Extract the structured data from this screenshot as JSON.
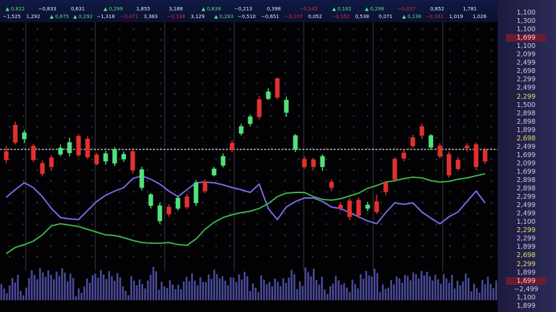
{
  "ticker": {
    "row1": [
      {
        "v": "0,822",
        "dir": "up"
      },
      {
        "v": "−0,833",
        "dir": "flat"
      },
      {
        "v": "0,631",
        "dir": "flat"
      },
      {
        "v": "0,299",
        "dir": "up"
      },
      {
        "v": "1,855",
        "dir": "flat"
      },
      {
        "v": "3,188",
        "dir": "flat"
      },
      {
        "v": "0,839",
        "dir": "up"
      },
      {
        "v": "−0,213",
        "dir": "flat"
      },
      {
        "v": "0,398",
        "dir": "flat"
      },
      {
        "v": "−0,145",
        "dir": "down"
      },
      {
        "v": "0,162",
        "dir": "up"
      },
      {
        "v": "0,298",
        "dir": "up"
      },
      {
        "v": "−0,037",
        "dir": "down"
      },
      {
        "v": "0,852",
        "dir": "flat"
      },
      {
        "v": "1,781",
        "dir": "flat"
      }
    ],
    "row2": [
      {
        "v": "−1,525",
        "dir": "flat"
      },
      {
        "v": "1,292",
        "dir": "flat"
      },
      {
        "v": "0,675",
        "dir": "up"
      },
      {
        "v": "0,292",
        "dir": "up"
      },
      {
        "v": "−1,318",
        "dir": "flat"
      },
      {
        "v": "−0,471",
        "dir": "down"
      },
      {
        "v": "3,383",
        "dir": "flat"
      },
      {
        "v": "−0,138",
        "dir": "down"
      },
      {
        "v": "3,129",
        "dir": "flat"
      },
      {
        "v": "0,293",
        "dir": "up"
      },
      {
        "v": "−0,510",
        "dir": "flat"
      },
      {
        "v": "−0,651",
        "dir": "flat"
      },
      {
        "v": "−0,107",
        "dir": "down"
      },
      {
        "v": "0,052",
        "dir": "flat"
      },
      {
        "v": "−0,152",
        "dir": "down"
      },
      {
        "v": "0,538",
        "dir": "flat"
      },
      {
        "v": "0,071",
        "dir": "flat"
      },
      {
        "v": "0,138",
        "dir": "up"
      },
      {
        "v": "−0,161",
        "dir": "down"
      },
      {
        "v": "1,019",
        "dir": "flat"
      },
      {
        "v": "1,026",
        "dir": "flat"
      }
    ]
  },
  "y_axis_labels": [
    {
      "t": "1,100",
      "c": "w"
    },
    {
      "t": "1,300",
      "c": "w"
    },
    {
      "t": "1,100",
      "c": "w"
    },
    {
      "t": "1,699",
      "c": "hl"
    },
    {
      "t": "1,100",
      "c": "w"
    },
    {
      "t": "2,099",
      "c": "w"
    },
    {
      "t": "2,499",
      "c": "w"
    },
    {
      "t": "2,698",
      "c": "w"
    },
    {
      "t": "2,299",
      "c": "w"
    },
    {
      "t": "2,499",
      "c": "w"
    },
    {
      "t": "2,299",
      "c": "y"
    },
    {
      "t": "1,500",
      "c": "w"
    },
    {
      "t": "2,898",
      "c": "w"
    },
    {
      "t": "2,898",
      "c": "w"
    },
    {
      "t": "1,899",
      "c": "w"
    },
    {
      "t": "2,698",
      "c": "y"
    },
    {
      "t": "2,499",
      "c": "w"
    },
    {
      "t": "1,699",
      "c": "w"
    },
    {
      "t": "2,099",
      "c": "w"
    },
    {
      "t": "1,699",
      "c": "w"
    },
    {
      "t": "2,898",
      "c": "w"
    },
    {
      "t": "2,898",
      "c": "w"
    },
    {
      "t": "2,299",
      "c": "w"
    },
    {
      "t": "2,499",
      "c": "w"
    },
    {
      "t": "2,499",
      "c": "w"
    },
    {
      "t": "1,100",
      "c": "w"
    },
    {
      "t": "2,299",
      "c": "y"
    },
    {
      "t": "2,299",
      "c": "w"
    },
    {
      "t": "1,899",
      "c": "w"
    },
    {
      "t": "2,698",
      "c": "y"
    },
    {
      "t": "2,299",
      "c": "y"
    },
    {
      "t": "1,899",
      "c": "w"
    },
    {
      "t": "1,699",
      "c": "hl"
    },
    {
      "t": "−2,499",
      "c": "w"
    },
    {
      "t": "1,100",
      "c": "w"
    },
    {
      "t": "1,899",
      "c": "w"
    }
  ],
  "colors": {
    "up": "#52e07a",
    "down": "#e03030",
    "line_purple": "#7a6ae8",
    "line_green": "#3cb04a",
    "volume": "#4a4a9c",
    "reference_line": "#ffffff"
  },
  "chart_data": {
    "type": "candlestick",
    "x": [
      1,
      2,
      3,
      4,
      5,
      6,
      7,
      8,
      9,
      10,
      11,
      12,
      13,
      14,
      15,
      16,
      17,
      18,
      19,
      20,
      21,
      22,
      23,
      24,
      25,
      26,
      27,
      28,
      29,
      30,
      31,
      32,
      33,
      34,
      35,
      36,
      37,
      38,
      39,
      40,
      41,
      42,
      43,
      44,
      45,
      46,
      47,
      48,
      49,
      50,
      51,
      52,
      53,
      54
    ],
    "candles": [
      {
        "o": 218,
        "c": 230,
        "h": 210,
        "l": 235
      },
      {
        "o": 180,
        "c": 205,
        "h": 175,
        "l": 208
      },
      {
        "o": 200,
        "c": 191,
        "h": 187,
        "l": 206
      },
      {
        "o": 210,
        "c": 230,
        "h": 207,
        "l": 233
      },
      {
        "o": 235,
        "c": 250,
        "h": 231,
        "l": 254
      },
      {
        "o": 227,
        "c": 240,
        "h": 223,
        "l": 245
      },
      {
        "o": 222,
        "c": 213,
        "h": 208,
        "l": 225
      },
      {
        "o": 220,
        "c": 205,
        "h": 198,
        "l": 225
      },
      {
        "o": 196,
        "c": 223,
        "h": 193,
        "l": 226
      },
      {
        "o": 200,
        "c": 226,
        "h": 196,
        "l": 229
      },
      {
        "o": 223,
        "c": 236,
        "h": 220,
        "l": 238
      },
      {
        "o": 232,
        "c": 221,
        "h": 217,
        "l": 237
      },
      {
        "o": 235,
        "c": 215,
        "h": 212,
        "l": 239
      },
      {
        "o": 229,
        "c": 222,
        "h": 218,
        "l": 233
      },
      {
        "o": 218,
        "c": 245,
        "h": 215,
        "l": 250
      },
      {
        "o": 270,
        "c": 244,
        "h": 240,
        "l": 274
      },
      {
        "o": 296,
        "c": 280,
        "h": 278,
        "l": 300
      },
      {
        "o": 318,
        "c": 296,
        "h": 292,
        "l": 322
      },
      {
        "o": 298,
        "c": 308,
        "h": 294,
        "l": 312
      },
      {
        "o": 300,
        "c": 285,
        "h": 282,
        "l": 303
      },
      {
        "o": 283,
        "c": 298,
        "h": 279,
        "l": 301
      },
      {
        "o": 292,
        "c": 263,
        "h": 259,
        "l": 296
      },
      {
        "o": 262,
        "c": 275,
        "h": 258,
        "l": 278
      },
      {
        "o": 252,
        "c": 243,
        "h": 240,
        "l": 254
      },
      {
        "o": 238,
        "c": 225,
        "h": 221,
        "l": 241
      },
      {
        "o": 206,
        "c": 216,
        "h": 202,
        "l": 219
      },
      {
        "o": 192,
        "c": 182,
        "h": 178,
        "l": 195
      },
      {
        "o": 178,
        "c": 168,
        "h": 165,
        "l": 182
      },
      {
        "o": 143,
        "c": 168,
        "h": 138,
        "l": 172
      },
      {
        "o": 142,
        "c": 132,
        "h": 127,
        "l": 144
      },
      {
        "o": 113,
        "c": 140,
        "h": 112,
        "l": 143
      },
      {
        "o": 162,
        "c": 144,
        "h": 139,
        "l": 168
      },
      {
        "o": 215,
        "c": 195,
        "h": 193,
        "l": 219
      },
      {
        "o": 229,
        "c": 240,
        "h": 225,
        "l": 243
      },
      {
        "o": 230,
        "c": 240,
        "h": 227,
        "l": 244
      },
      {
        "o": 240,
        "c": 225,
        "h": 222,
        "l": 246
      },
      {
        "o": 262,
        "c": 270,
        "h": 258,
        "l": 275
      },
      {
        "o": 295,
        "c": 300,
        "h": 291,
        "l": 304
      },
      {
        "o": 289,
        "c": 312,
        "h": 285,
        "l": 317
      },
      {
        "o": 288,
        "c": 310,
        "h": 284,
        "l": 314
      },
      {
        "o": 300,
        "c": 295,
        "h": 291,
        "l": 304
      },
      {
        "o": 290,
        "c": 305,
        "h": 280,
        "l": 308
      },
      {
        "o": 263,
        "c": 276,
        "h": 260,
        "l": 281
      },
      {
        "o": 229,
        "c": 258,
        "h": 226,
        "l": 262
      },
      {
        "o": 220,
        "c": 228,
        "h": 215,
        "l": 232
      },
      {
        "o": 198,
        "c": 210,
        "h": 194,
        "l": 213
      },
      {
        "o": 182,
        "c": 195,
        "h": 178,
        "l": 200
      },
      {
        "o": 212,
        "c": 195,
        "h": 193,
        "l": 216
      },
      {
        "o": 210,
        "c": 225,
        "h": 206,
        "l": 228
      },
      {
        "o": 222,
        "c": 252,
        "h": 218,
        "l": 256
      },
      {
        "o": 230,
        "c": 243,
        "h": 226,
        "l": 246
      },
      {
        "o": 210,
        "c": 212,
        "h": 206,
        "l": 218
      },
      {
        "o": 208,
        "c": 240,
        "h": 205,
        "l": 244
      },
      {
        "o": 216,
        "c": 232,
        "h": 213,
        "l": 236
      }
    ],
    "series": [
      {
        "values": [
          284,
          273,
          263,
          270,
          283,
          300,
          313,
          315,
          316,
          303,
          290,
          281,
          275,
          270,
          257,
          253,
          258,
          265,
          275,
          283,
          273,
          263,
          262,
          263,
          266,
          270,
          273,
          277,
          265,
          300,
          316,
          298,
          290,
          285,
          285,
          290,
          298,
          300,
          306,
          312,
          318,
          322,
          306,
          292,
          294,
          292,
          305,
          314,
          322,
          312,
          305,
          290,
          275,
          292
        ]
      },
      {
        "values": [
          365,
          356,
          352,
          347,
          338,
          325,
          322,
          324,
          326,
          330,
          334,
          338,
          339,
          342,
          346,
          349,
          350,
          350,
          349,
          352,
          353,
          344,
          330,
          320,
          313,
          309,
          306,
          304,
          300,
          293,
          283,
          278,
          277,
          277,
          283,
          287,
          288,
          286,
          282,
          278,
          271,
          267,
          262,
          260,
          257,
          255,
          256,
          260,
          262,
          261,
          258,
          256,
          253,
          250
        ]
      }
    ],
    "volume": [
      415,
      398,
      415,
      395,
      390,
      392,
      392,
      398,
      418,
      402,
      393,
      393,
      394,
      418,
      402,
      405,
      390,
      410,
      406,
      411,
      398,
      402,
      396,
      394,
      402,
      396,
      397,
      412,
      399,
      407,
      405,
      391,
      406,
      391,
      401,
      413,
      403,
      412,
      405,
      396,
      391,
      412,
      404,
      400,
      395,
      391,
      397,
      400,
      397,
      410,
      398,
      411,
      404,
      408
    ],
    "reference_level": 215
  }
}
